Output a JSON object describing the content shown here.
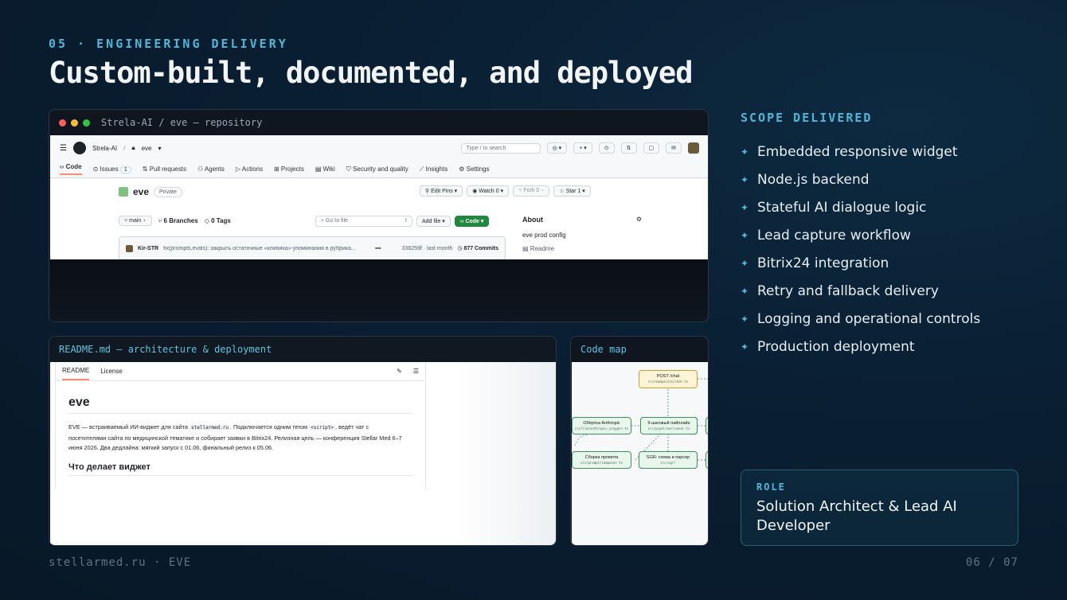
{
  "header": {
    "eyebrow": "05 · ENGINEERING DELIVERY",
    "title": "Custom-built, documented, and deployed"
  },
  "repo_window": {
    "title": "Strela-AI / eve — repository",
    "github": {
      "breadcrumb_org": "Strela-AI",
      "breadcrumb_sep": "/",
      "breadcrumb_repo": "eve",
      "search_placeholder": "Type / to search",
      "tabs": [
        {
          "label": "Code"
        },
        {
          "label": "Issues",
          "count": "1"
        },
        {
          "label": "Pull requests"
        },
        {
          "label": "Agents"
        },
        {
          "label": "Actions"
        },
        {
          "label": "Projects"
        },
        {
          "label": "Wiki"
        },
        {
          "label": "Security and quality"
        },
        {
          "label": "Insights"
        },
        {
          "label": "Settings"
        }
      ],
      "repo_name": "eve",
      "visibility": "Private",
      "edit_pins": "Edit Pins",
      "watch": "Watch",
      "watch_count": "0",
      "fork": "Fork",
      "fork_count": "0",
      "star": "Star",
      "star_count": "1",
      "branch": "main",
      "branches": "6 Branches",
      "tags": "0 Tags",
      "go_to_file": "Go to file",
      "go_to_file_key": "t",
      "add_file": "Add file",
      "code_button": "Code",
      "commit_author": "Kir-STR",
      "commit_message": "fix(prompts,evals): закрыть остаточные «клиника»-упоминания в рубрика...",
      "commit_hash_time": "338259f · last month",
      "commits": "877 Commits",
      "about_title": "About",
      "about_desc": "eve prod config",
      "readme_link": "Readme"
    }
  },
  "readme_window": {
    "title": "README.md — architecture & deployment",
    "tabs": [
      "README",
      "License"
    ],
    "heading": "eve",
    "para_parts": [
      "EVE — встраиваемый ИИ-виджет для сайта ",
      "stellarmed.ru",
      ". Подключается одним тегом ",
      "<script>",
      ", ведёт чат с посетителями сайта по медицинской тематике и собирает заявки в Bitrix24. Релизная цель — конференция Stellar Med 6–7 июня 2026. Два дедлайна: мягкий запуск с 01.06, финальный релиз к 05.06."
    ],
    "subheading": "Что делает виджет"
  },
  "code_window": {
    "title": "Code map",
    "nodes": [
      {
        "label": "POST /chat",
        "path": "src/endpoints/chat.ts"
      },
      {
        "label": "Обёртка Anthropic",
        "path": "src/llm/anthropic_wrapper.ts"
      },
      {
        "label": "9-шаговый пайплайн",
        "path": "src/pipeline/runner.ts"
      },
      {
        "label": "Сборка промпта",
        "path": "src/prompt/composer.ts"
      },
      {
        "label": "SGR: схема и парсер",
        "path": "src/sgr/"
      }
    ]
  },
  "scope": {
    "heading": "SCOPE DELIVERED",
    "items": [
      "Embedded responsive widget",
      "Node.js backend",
      "Stateful AI dialogue logic",
      "Lead capture workflow",
      "Bitrix24 integration",
      "Retry and fallback delivery",
      "Logging and operational controls",
      "Production deployment"
    ]
  },
  "role": {
    "label": "ROLE",
    "text": "Solution Architect & Lead AI Developer"
  },
  "footer": {
    "left": "stellarmed.ru · EVE",
    "right": "06 / 07"
  },
  "colors": {
    "accent": "#4fb8d8",
    "background": "#0a1f33",
    "github_green": "#1f883d",
    "dot_red": "#ff5f57",
    "dot_yellow": "#febc2e",
    "dot_green": "#28c840"
  }
}
